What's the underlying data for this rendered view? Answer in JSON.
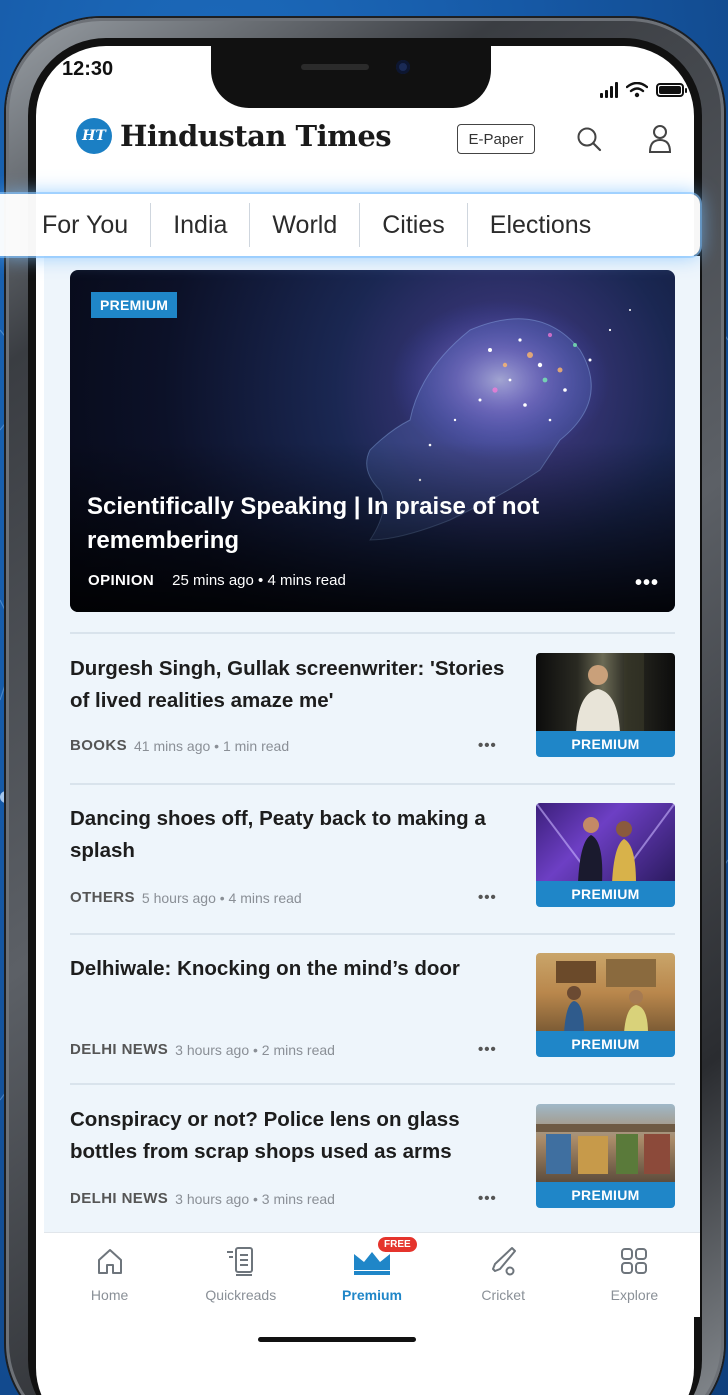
{
  "status_bar": {
    "time": "12:30"
  },
  "header": {
    "logo_badge": "HT",
    "logo_text": "Hindustan Times",
    "epaper_label": "E-Paper"
  },
  "tabs": [
    {
      "label": "For You"
    },
    {
      "label": "India"
    },
    {
      "label": "World"
    },
    {
      "label": "Cities"
    },
    {
      "label": "Elections"
    }
  ],
  "hero": {
    "badge": "PREMIUM",
    "title": "Scientifically Speaking | In praise of not remembering",
    "category": "OPINION",
    "meta": "25 mins ago • 4 mins read",
    "more": "•••"
  },
  "articles": [
    {
      "title": "Durgesh Singh, Gullak screenwriter: 'Stories of lived realities amaze me'",
      "category": "BOOKS",
      "meta": "41 mins ago • 1 min read",
      "badge": "PREMIUM",
      "more": "•••"
    },
    {
      "title": "Dancing shoes off, Peaty back to making a splash",
      "category": "OTHERS",
      "meta": "5 hours ago • 4 mins read",
      "badge": "PREMIUM",
      "more": "•••"
    },
    {
      "title": "Delhiwale: Knocking on the mind’s door",
      "category": "DELHI NEWS",
      "meta": "3 hours ago • 2 mins read",
      "badge": "PREMIUM",
      "more": "•••"
    },
    {
      "title": "Conspiracy or not? Police lens on glass bottles from scrap shops used as arms",
      "category": "DELHI NEWS",
      "meta": "3 hours ago • 3 mins read",
      "badge": "PREMIUM",
      "more": "•••"
    }
  ],
  "bottom_nav": [
    {
      "label": "Home",
      "icon": "home-icon"
    },
    {
      "label": "Quickreads",
      "icon": "quickreads-icon"
    },
    {
      "label": "Premium",
      "icon": "crown-icon",
      "badge": "FREE",
      "active": true
    },
    {
      "label": "Cricket",
      "icon": "cricket-bat-icon"
    },
    {
      "label": "Explore",
      "icon": "grid-icon"
    }
  ],
  "colors": {
    "accent": "#1f86c8",
    "badge_red": "#e5342c",
    "background": "#1659a6"
  }
}
